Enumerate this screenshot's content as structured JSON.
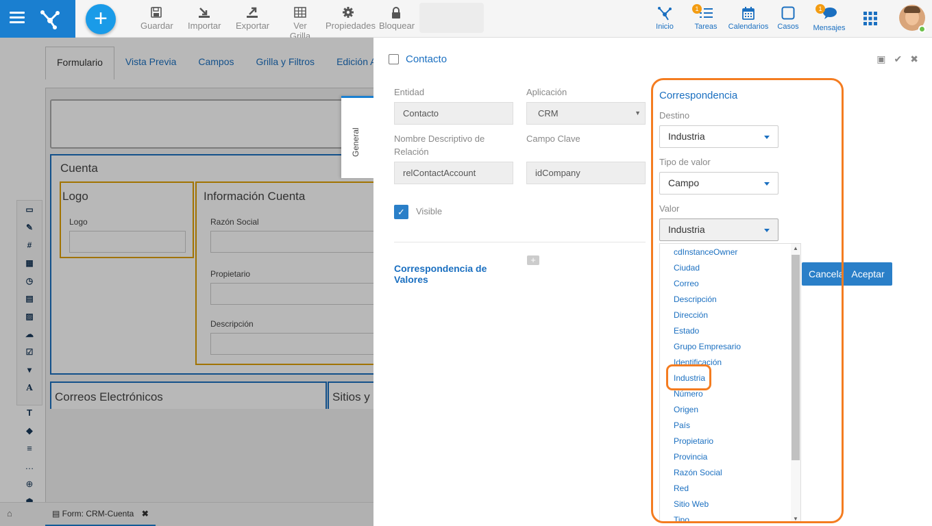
{
  "toolbar": {
    "guardar": "Guardar",
    "importar": "Importar",
    "exportar": "Exportar",
    "ver_grilla": "Ver Grilla",
    "propiedades": "Propiedades",
    "bloquear": "Bloquear"
  },
  "nav": {
    "inicio": "Inicio",
    "tareas": "Tareas",
    "tareas_badge": "1",
    "calendarios": "Calendarios",
    "casos": "Casos",
    "mensajes": "Mensajes",
    "mensajes_badge": "1"
  },
  "form_tabs": [
    "Formulario",
    "Vista Previa",
    "Campos",
    "Grilla y Filtros",
    "Edición Ava"
  ],
  "form": {
    "cuenta_title": "Cuenta",
    "logo_title": "Logo",
    "logo_label": "Logo",
    "info_title": "Información Cuenta",
    "razon_social_label": "Razón Social",
    "propietario_label": "Propietario",
    "descripcion_label": "Descripción",
    "correos_title": "Correos Electrónicos",
    "sitios_title": "Sitios y"
  },
  "side_tab": "General",
  "footer_tab": "Form: CRM-Cuenta",
  "panel": {
    "title": "Contacto",
    "entidad_label": "Entidad",
    "entidad_value": "Contacto",
    "aplicacion_label": "Aplicación",
    "aplicacion_value": "CRM",
    "nombre_label": "Nombre Descriptivo de Relación",
    "nombre_value": "relContactAccount",
    "campo_clave_label": "Campo Clave",
    "campo_clave_value": "idCompany",
    "visible_label": "Visible",
    "corr_valores_title": "Correspondencia de Valores",
    "corr_title": "Correspondencia",
    "destino_label": "Destino",
    "destino_value": "Industria",
    "tipo_label": "Tipo de valor",
    "tipo_value": "Campo",
    "valor_label": "Valor",
    "valor_value": "Industria",
    "options": [
      "cdInstanceOwner",
      "Ciudad",
      "Correo",
      "Descripción",
      "Dirección",
      "Estado",
      "Grupo Empresario",
      "Identificación",
      "Industria",
      "Número",
      "Origen",
      "País",
      "Propietario",
      "Provincia",
      "Razón Social",
      "Red",
      "Sitio Web",
      "Tipo"
    ],
    "cancel_label": "Cancela",
    "ok_label": "Aceptar"
  }
}
